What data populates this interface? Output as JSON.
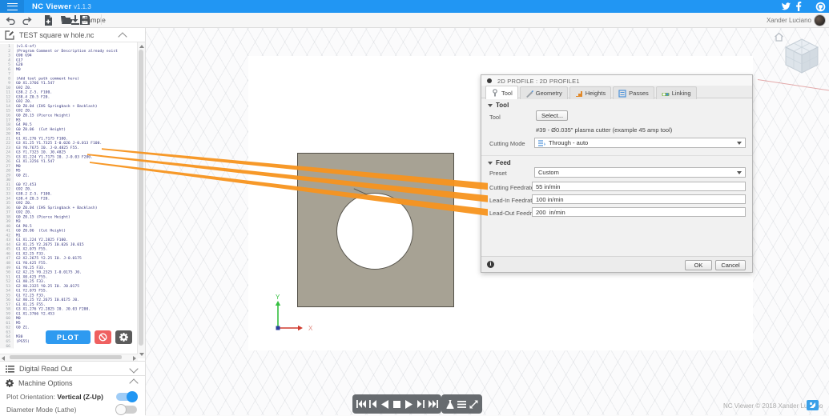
{
  "navbar": {
    "app_title": "NC Viewer",
    "version": "v1.1.3",
    "user_name": "Xander Luciano",
    "social_icons": [
      "twitter",
      "facebook",
      "github"
    ]
  },
  "toolbar": {
    "sample_label": "Sample",
    "icons": [
      "undo",
      "redo",
      "new-file",
      "open-file",
      "save-file",
      "download-sample"
    ]
  },
  "editor": {
    "filename": "TEST square w hole.nc",
    "plot_button": "PLOT",
    "lines": [
      "(v1.6-af)",
      "(Program Comment or Description already exist",
      "G90 G94",
      "G17",
      "G20",
      "M0",
      "",
      "(Add tool path comment here)",
      "G0 X1.3766 Y1.547",
      "G92 Z0.",
      "G38.2 Z-5. F100.",
      "G38.4 Z0.5 F20.",
      "G92 Z0.",
      "G0 Z0.04 (IHS Springback + Backlash)",
      "G92 Z0.",
      "G0 Z0.15 (Pierce Height)",
      "M3",
      "G4 P0.5",
      "G0 Z0.06  (Cut Height)",
      "M1",
      "G1 X1.276 Y1.7175 F100.",
      "G3 X1.25 Y1.7325 I-0.026 J-0.013 F100.",
      "G3 Y0.7675 I0. J-0.4825 F55.",
      "G3 Y1.7325 I0. J0.4825",
      "G3 X1.224 Y1.7175 I0. J-0.03 F200.",
      "G1 X1.3256 Y1.547",
      "M0",
      "M5",
      "G0 Z1.",
      "",
      "G0 Y2.453",
      "G92 Z0.",
      "G38.2 Z-5. F100.",
      "G38.4 Z0.5 F20.",
      "G92 Z0.",
      "G0 Z0.04 (IHS Springback + Backlash)",
      "G92 Z0.",
      "G0 Z0.15 (Pierce Height)",
      "M3",
      "G4 P0.5",
      "G0 Z0.06  (Cut Height)",
      "M1",
      "G1 X1.224 Y2.2825 F100.",
      "G3 X1.25 Y2.2675 I0.026 J0.015",
      "G1 X2.075 F55.",
      "G1 X2.25 F33.",
      "G2 X2.2675 Y2.25 I0. J-0.0175",
      "G1 Y0.425 F55.",
      "G1 Y0.25 F33.",
      "G2 X2.25 Y0.2325 I-0.0175 J0.",
      "G1 X0.425 F55.",
      "G1 X0.25 F33.",
      "G2 X0.2325 Y0.25 I0. J0.0175",
      "G1 Y2.075 F55.",
      "G1 Y2.25 F33.",
      "G2 X0.25 Y2.2675 I0.0175 J0.",
      "G1 X1.25 F55.",
      "G3 X1.276 Y2.2825 I0. J0.03 F200.",
      "G1 X1.3766 Y2.453",
      "M0",
      "M5",
      "G0 Z1.",
      "",
      "M30",
      "(PS55)",
      ""
    ]
  },
  "panels": {
    "dro_title": "Digital Read Out",
    "machine_title": "Machine Options",
    "plot_orientation_label": "Plot Orientation:",
    "plot_orientation_value": "Vertical (Z-Up)",
    "plot_orientation_on": true,
    "diameter_label": "Diameter Mode (Lathe)",
    "diameter_on": false
  },
  "viewport": {
    "axis_x_label": "X",
    "axis_y_label": "Y",
    "copyright": "NC Viewer © 2018 Xander Luciano"
  },
  "dialog": {
    "title": "2D PROFILE : 2D PROFILE1",
    "tabs": [
      {
        "label": "Tool",
        "active": true
      },
      {
        "label": "Geometry",
        "active": false
      },
      {
        "label": "Heights",
        "active": false
      },
      {
        "label": "Passes",
        "active": false
      },
      {
        "label": "Linking",
        "active": false
      }
    ],
    "tool_section": {
      "title": "Tool",
      "tool_label": "Tool",
      "select_button": "Select...",
      "tool_description": "#39 - Ø0.035\" plasma cutter (example 45 amp tool)",
      "cutting_mode_label": "Cutting Mode",
      "cutting_mode_value": "Through - auto"
    },
    "feed_section": {
      "title": "Feed",
      "preset_label": "Preset",
      "preset_value": "Custom",
      "fields": [
        {
          "label": "Cutting Feedrate",
          "value": "55 in/min"
        },
        {
          "label": "Lead-In Feedrate",
          "value": "100 in/min"
        },
        {
          "label": "Lead-Out Feedrate",
          "value": "200  in/min"
        }
      ]
    },
    "ok_button": "OK",
    "cancel_button": "Cancel"
  },
  "colors": {
    "accent_blue": "#2196F3",
    "annotation_orange": "#F7941E",
    "plot_square_fill": "#A7A294",
    "toggle_on": "#2196F3"
  }
}
